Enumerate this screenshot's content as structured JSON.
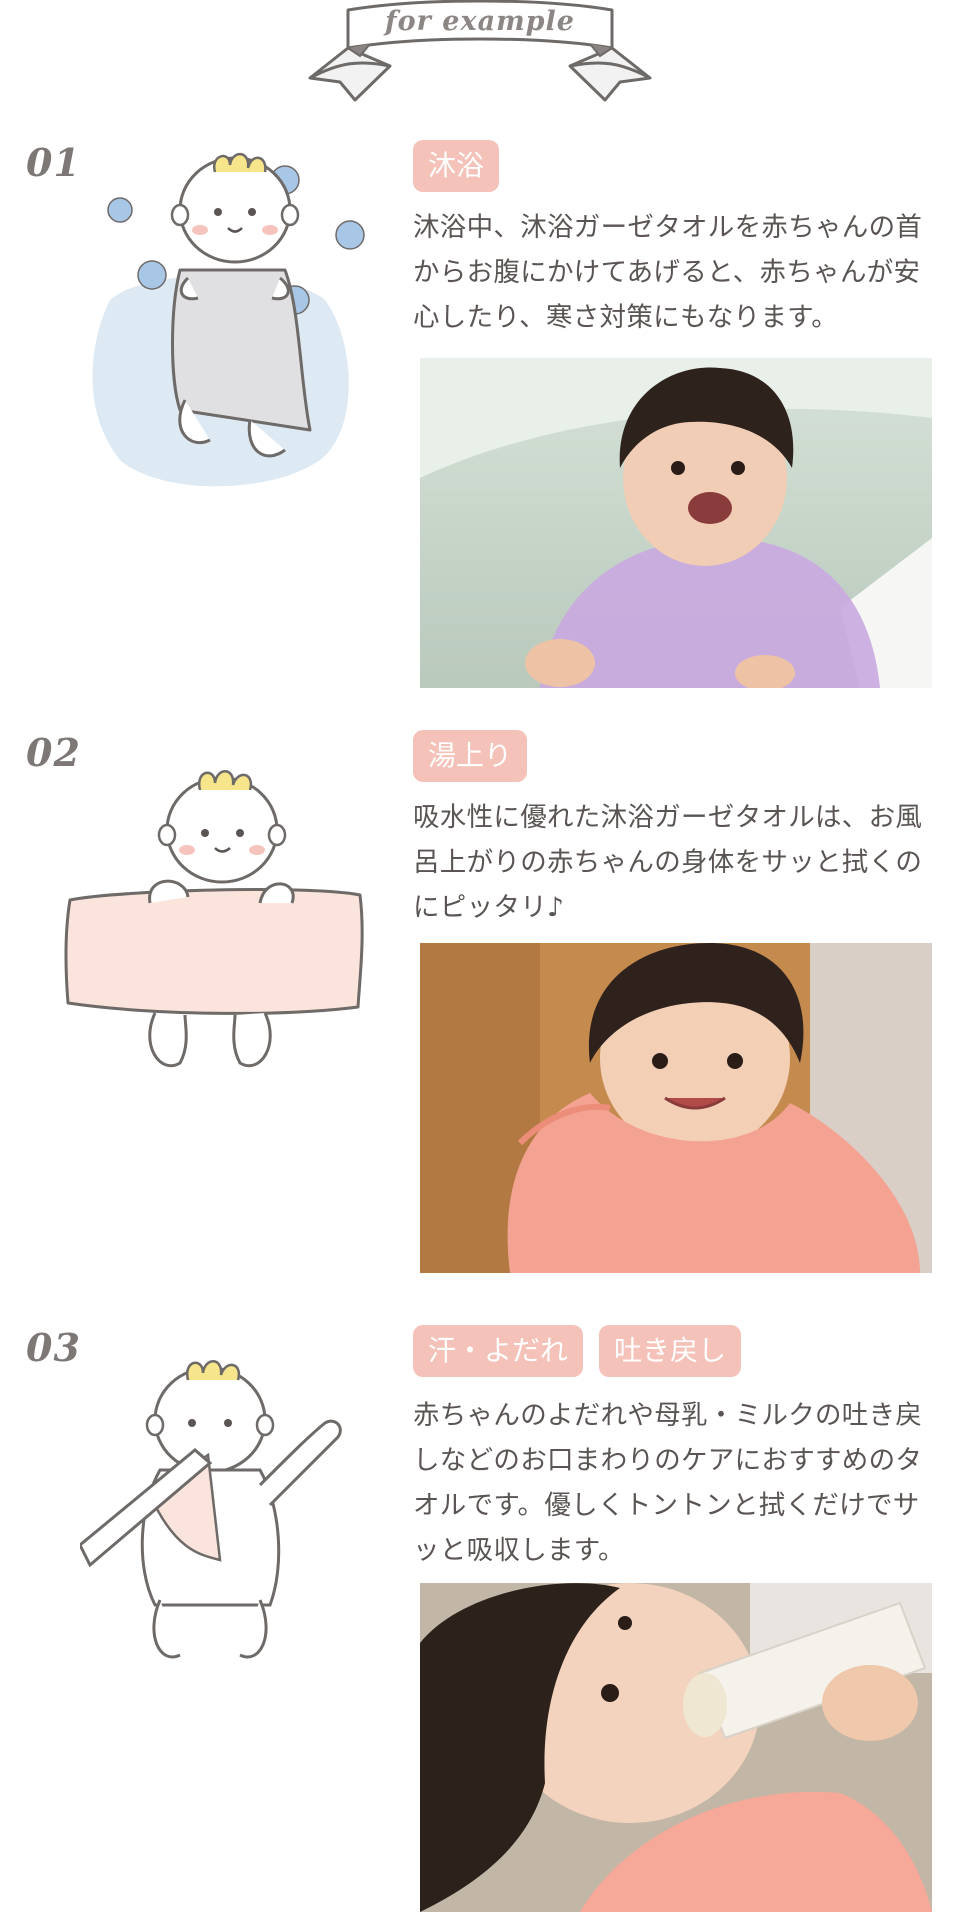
{
  "header": {
    "banner_text": "for example"
  },
  "sections": [
    {
      "number": "01",
      "tags": [
        "沐浴"
      ],
      "description": "沐浴中、沐浴ガーゼタオルを赤ちゃんの首からお腹にかけてあげると、赤ちゃんが安心したり、寒さ対策にもなります。"
    },
    {
      "number": "02",
      "tags": [
        "湯上り"
      ],
      "description": "吸水性に優れた沐浴ガーゼタオルは、お風呂上がりの赤ちゃんの身体をサッと拭くのにピッタリ♪"
    },
    {
      "number": "03",
      "tags": [
        "汗・よだれ",
        "吐き戻し"
      ],
      "description": "赤ちゃんのよだれや母乳・ミルクの吐き戻しなどのお口まわりのケアにおすすめのタオルです。優しくトントンと拭くだけでサッと吸収します。"
    }
  ],
  "colors": {
    "tag_bg": "#f4c2b8",
    "text": "#5a5553",
    "bath_blue": "#dde9f3",
    "towel_pink": "#fbe4dc",
    "hair_yellow": "#f6e58a",
    "bubble_blue": "#a8c6e6",
    "cheek_pink": "#f7c3bd"
  },
  "icons": [
    "ribbon-banner",
    "baby-in-bath-illustration",
    "baby-with-towel-illustration",
    "baby-wiping-mouth-illustration"
  ]
}
